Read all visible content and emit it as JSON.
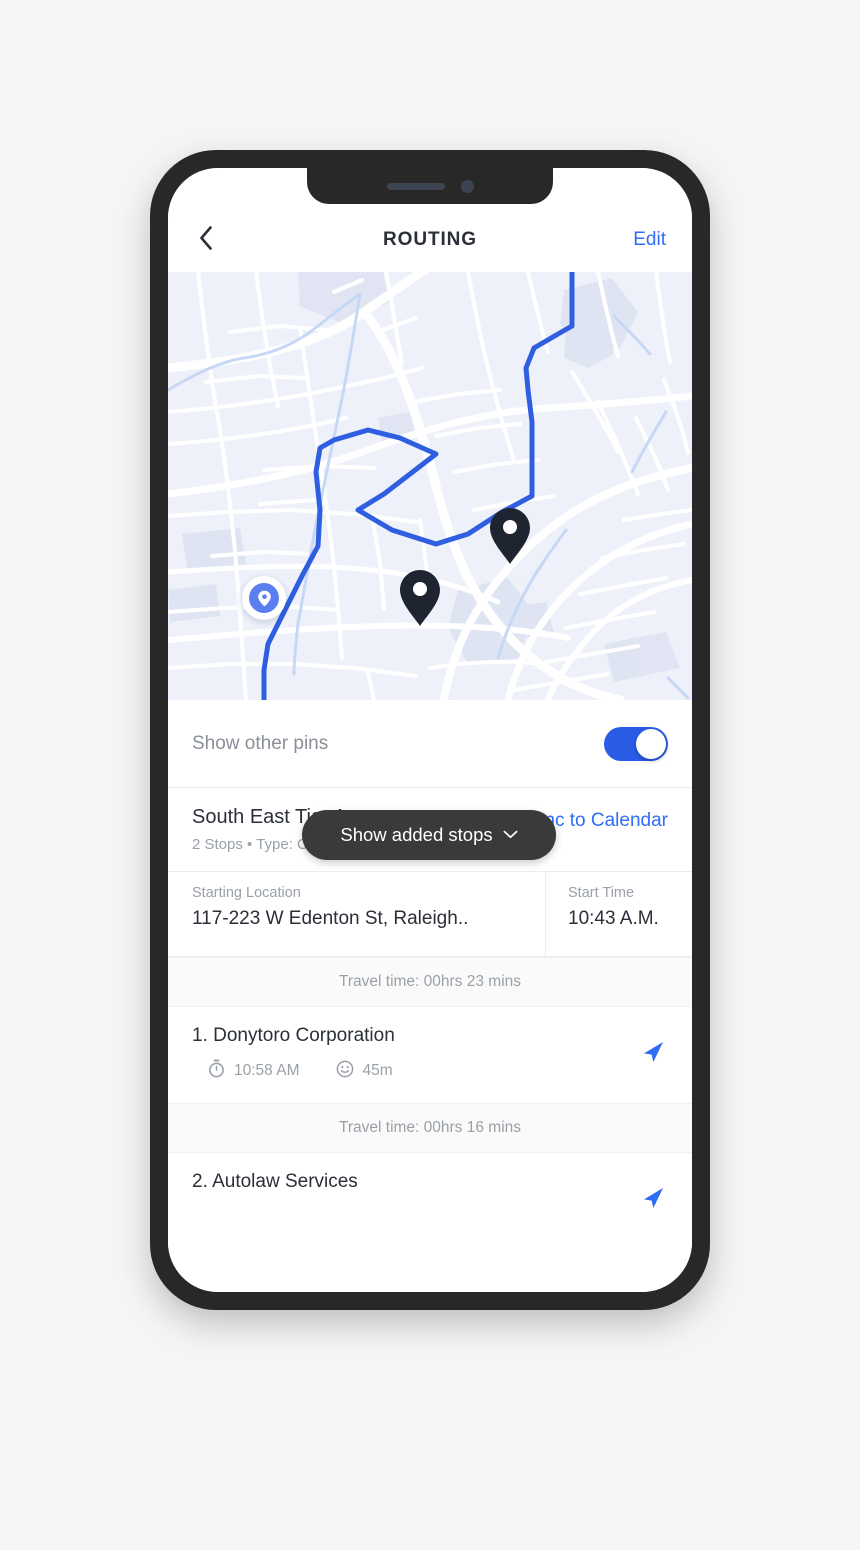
{
  "header": {
    "back_icon": "chevron-left-icon",
    "title": "ROUTING",
    "edit_label": "Edit"
  },
  "map": {
    "start_marker_icon": "map-pin-icon",
    "pill": {
      "label": "Show added stops",
      "chevron_icon": "chevron-down-icon"
    },
    "pin_count": 4,
    "route_color": "#2f5fe0",
    "pin_color": "#1e2531",
    "background_color": "#eef1fa",
    "road_color": "#ffffff",
    "water_color": "#c6d8f5"
  },
  "sheet": {
    "other_pins": {
      "label": "Show other pins",
      "toggle_on": true,
      "toggle_color": "#2b5ce6"
    },
    "route": {
      "name": "South East Tier A",
      "meta": "2 Stops  •  Type: Optimize",
      "sync_label": "Sync to Calendar"
    },
    "start_info": {
      "location_label": "Starting Location",
      "location_value": "117-223 W Edenton St, Raleigh..",
      "time_label": "Start Time",
      "time_value": "10:43 A.M."
    },
    "travel_bands": [
      "Travel time: 00hrs 23 mins",
      "Travel time: 00hrs 16 mins"
    ],
    "stops": [
      {
        "title": "1. Donytoro Corporation",
        "time_icon": "stopwatch-icon",
        "time": "10:58 AM",
        "duration_icon": "smiley-icon",
        "duration": "45m",
        "nav_icon": "navigate-arrow-icon"
      },
      {
        "title": "2. Autolaw Services",
        "nav_icon": "navigate-arrow-icon"
      }
    ]
  },
  "colors": {
    "accent_blue": "#2f6df6",
    "text_dark": "#2b2f38",
    "text_muted": "#9aa0a8",
    "pill_dark": "#3a3a3a",
    "page_bg": "#f5f5f5"
  }
}
